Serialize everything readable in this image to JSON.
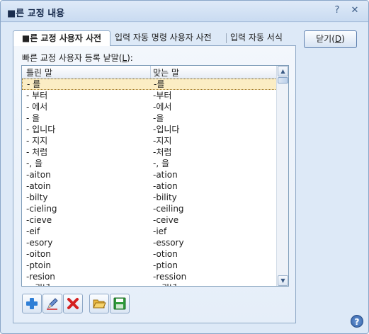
{
  "window": {
    "title": "■른 교정 내용",
    "help_glyph": "?",
    "close_glyph": "✕"
  },
  "tabs": [
    {
      "label": "■른 교정 사용자 사전",
      "active": true
    },
    {
      "label": "입력 자동 명령 사용자 사전",
      "active": false
    },
    {
      "label": "입력 자동 서식",
      "active": false
    }
  ],
  "list_label": {
    "text": "빠른 교정 사용자 등록 낱말(",
    "mnemonic": "L",
    "suffix": "):"
  },
  "list": {
    "columns": [
      "틀린 말",
      "맞는 말"
    ],
    "rows": [
      [
        "- 를",
        "-를"
      ],
      [
        "- 부터",
        "-부터"
      ],
      [
        "- 에서",
        "-에서"
      ],
      [
        "- 을",
        "-을"
      ],
      [
        "- 입니다",
        "-입니다"
      ],
      [
        "- 지지",
        "-지지"
      ],
      [
        "- 처럼",
        "-처럼"
      ],
      [
        "-, 을",
        "-, 을"
      ],
      [
        "-aiton",
        "-ation"
      ],
      [
        "-atoin",
        "-ation"
      ],
      [
        "-bilty",
        "-bility"
      ],
      [
        "-cieling",
        "-ceiling"
      ],
      [
        "-cieve",
        "-ceive"
      ],
      [
        "-eif",
        "-ief"
      ],
      [
        "-esory",
        "-essory"
      ],
      [
        "-oiton",
        "-otion"
      ],
      [
        "-ptoin",
        "-ption"
      ],
      [
        "-resion",
        "-ression"
      ],
      [
        "-, 권녕",
        "-, 권녕"
      ]
    ],
    "selected_index": 0
  },
  "buttons": {
    "close": {
      "text": "닫기(",
      "mnemonic": "D",
      "suffix": ")"
    },
    "help": "?"
  },
  "toolbar": [
    {
      "icon": "add-icon",
      "color": "#2f7fd6"
    },
    {
      "icon": "edit-icon",
      "color": "#4a6fb5"
    },
    {
      "icon": "delete-icon",
      "color": "#d42020"
    },
    {
      "icon": "open-folder-icon",
      "color": "#e0a82a"
    },
    {
      "icon": "save-icon",
      "color": "#2e9a3a"
    }
  ]
}
